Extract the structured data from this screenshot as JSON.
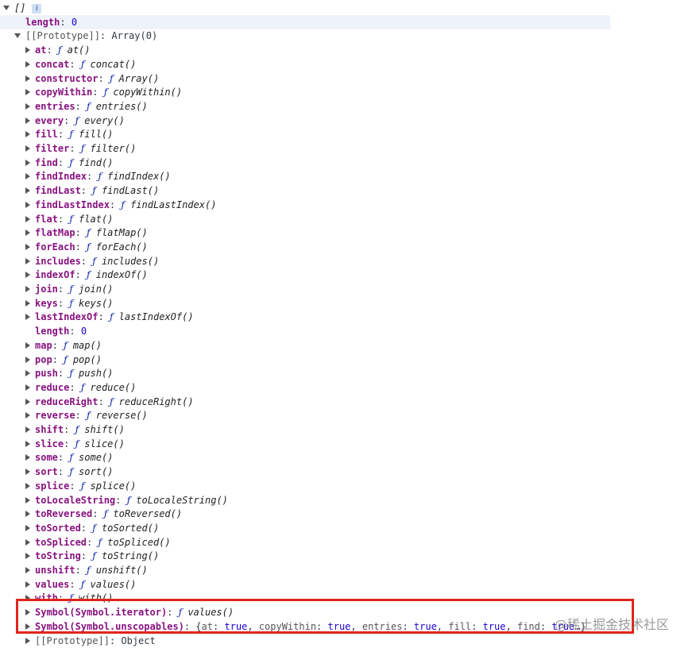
{
  "root": {
    "label": "[]",
    "info_icon": "info-icon"
  },
  "length_row": {
    "key": "length",
    "value": "0"
  },
  "prototype": {
    "key": "[[Prototype]]",
    "value": "Array(0)"
  },
  "methods": [
    {
      "key": "at",
      "fn": "at()"
    },
    {
      "key": "concat",
      "fn": "concat()"
    },
    {
      "key": "constructor",
      "fn": "Array()"
    },
    {
      "key": "copyWithin",
      "fn": "copyWithin()"
    },
    {
      "key": "entries",
      "fn": "entries()"
    },
    {
      "key": "every",
      "fn": "every()"
    },
    {
      "key": "fill",
      "fn": "fill()"
    },
    {
      "key": "filter",
      "fn": "filter()"
    },
    {
      "key": "find",
      "fn": "find()"
    },
    {
      "key": "findIndex",
      "fn": "findIndex()"
    },
    {
      "key": "findLast",
      "fn": "findLast()"
    },
    {
      "key": "findLastIndex",
      "fn": "findLastIndex()"
    },
    {
      "key": "flat",
      "fn": "flat()"
    },
    {
      "key": "flatMap",
      "fn": "flatMap()"
    },
    {
      "key": "forEach",
      "fn": "forEach()"
    },
    {
      "key": "includes",
      "fn": "includes()"
    },
    {
      "key": "indexOf",
      "fn": "indexOf()"
    },
    {
      "key": "join",
      "fn": "join()"
    },
    {
      "key": "keys",
      "fn": "keys()"
    },
    {
      "key": "lastIndexOf",
      "fn": "lastIndexOf()"
    }
  ],
  "proto_length": {
    "key": "length",
    "value": "0"
  },
  "methods2": [
    {
      "key": "map",
      "fn": "map()"
    },
    {
      "key": "pop",
      "fn": "pop()"
    },
    {
      "key": "push",
      "fn": "push()"
    },
    {
      "key": "reduce",
      "fn": "reduce()"
    },
    {
      "key": "reduceRight",
      "fn": "reduceRight()"
    },
    {
      "key": "reverse",
      "fn": "reverse()"
    },
    {
      "key": "shift",
      "fn": "shift()"
    },
    {
      "key": "slice",
      "fn": "slice()"
    },
    {
      "key": "some",
      "fn": "some()"
    },
    {
      "key": "sort",
      "fn": "sort()"
    },
    {
      "key": "splice",
      "fn": "splice()"
    },
    {
      "key": "toLocaleString",
      "fn": "toLocaleString()"
    },
    {
      "key": "toReversed",
      "fn": "toReversed()"
    },
    {
      "key": "toSorted",
      "fn": "toSorted()"
    },
    {
      "key": "toSpliced",
      "fn": "toSpliced()"
    },
    {
      "key": "toString",
      "fn": "toString()"
    },
    {
      "key": "unshift",
      "fn": "unshift()"
    },
    {
      "key": "values",
      "fn": "values()"
    },
    {
      "key": "with",
      "fn": "with()"
    }
  ],
  "symbol_iterator": {
    "key": "Symbol(Symbol.iterator)",
    "fn": "values()"
  },
  "symbol_unscopables": {
    "key": "Symbol(Symbol.unscopables)",
    "pairs": [
      {
        "k": "at",
        "v": "true"
      },
      {
        "k": "copyWithin",
        "v": "true"
      },
      {
        "k": "entries",
        "v": "true"
      },
      {
        "k": "fill",
        "v": "true"
      },
      {
        "k": "find",
        "v": "true"
      }
    ],
    "ellipsis": "…}"
  },
  "proto_object": {
    "key": "[[Prototype]]",
    "value": "Object"
  },
  "fn_glyph": "ƒ",
  "watermark": "@稀土掘金技术社区",
  "colors": {
    "highlight_box": "#e0241b",
    "key": "#881280",
    "number": "#1c00cf"
  }
}
